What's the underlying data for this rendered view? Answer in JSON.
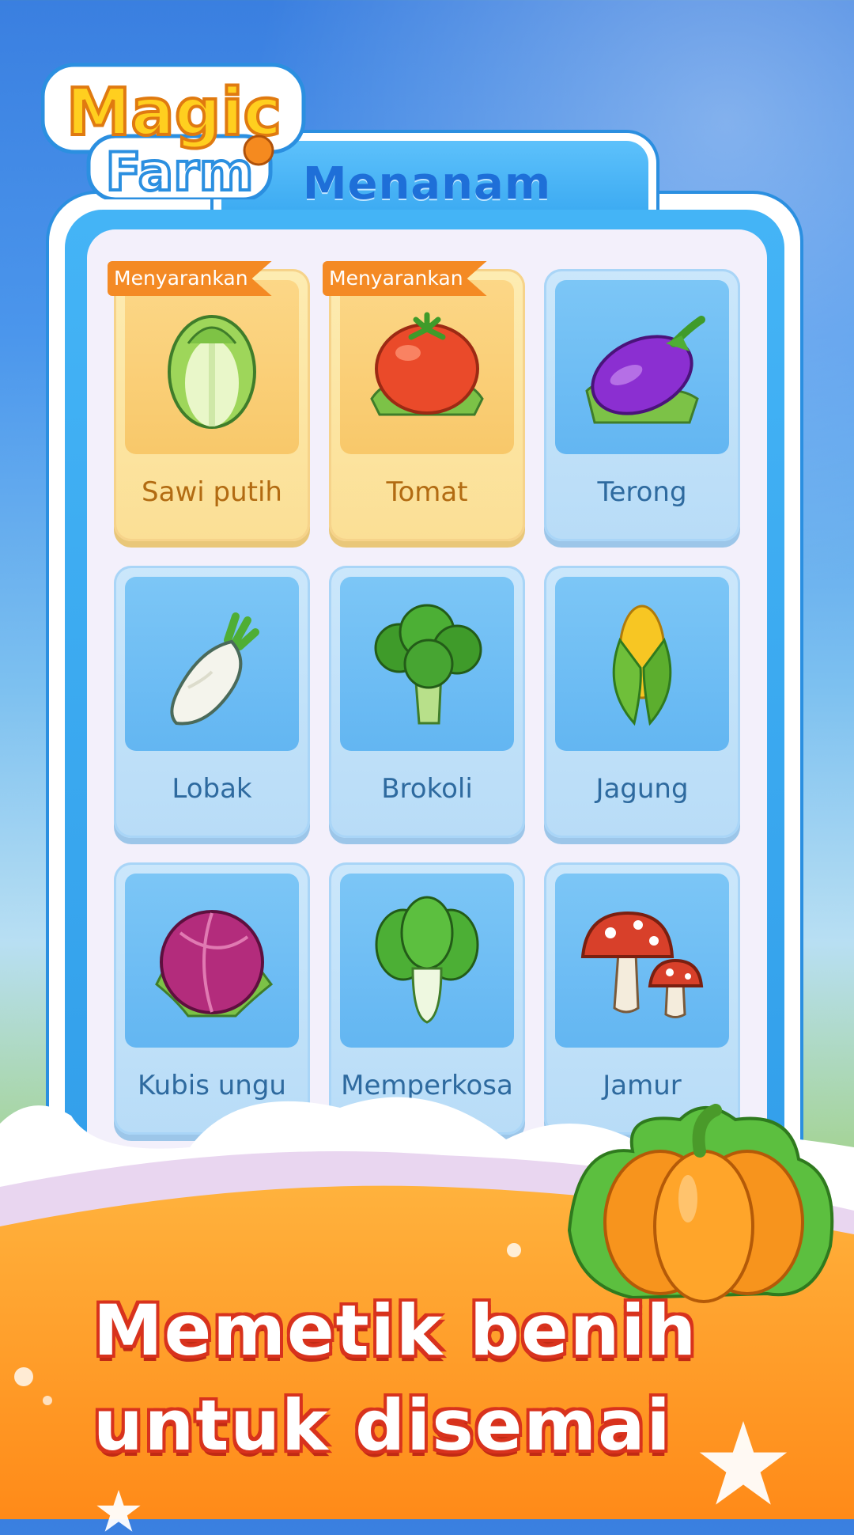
{
  "logo": {
    "line1": "Magic",
    "line2": "Farm"
  },
  "panel": {
    "title": "Menanam"
  },
  "ribbon_label": "Menyarankan",
  "crops": [
    {
      "name": "Sawi putih",
      "recommended": true,
      "icon": "chinese-cabbage-icon"
    },
    {
      "name": "Tomat",
      "recommended": true,
      "icon": "tomato-icon"
    },
    {
      "name": "Terong",
      "recommended": false,
      "icon": "eggplant-icon"
    },
    {
      "name": "Lobak",
      "recommended": false,
      "icon": "radish-icon"
    },
    {
      "name": "Brokoli",
      "recommended": false,
      "icon": "broccoli-icon"
    },
    {
      "name": "Jagung",
      "recommended": false,
      "icon": "corn-icon"
    },
    {
      "name": "Kubis ungu",
      "recommended": false,
      "icon": "red-cabbage-icon"
    },
    {
      "name": "Memperkosa",
      "recommended": false,
      "icon": "bok-choy-icon"
    },
    {
      "name": "Jamur",
      "recommended": false,
      "icon": "mushroom-icon"
    }
  ],
  "caption": {
    "line1": "Memetik benih",
    "line2": "untuk disemai"
  },
  "colors": {
    "accent_blue": "#2f9be8",
    "ribbon_orange": "#f48a24",
    "caption_red": "#d8321d"
  }
}
